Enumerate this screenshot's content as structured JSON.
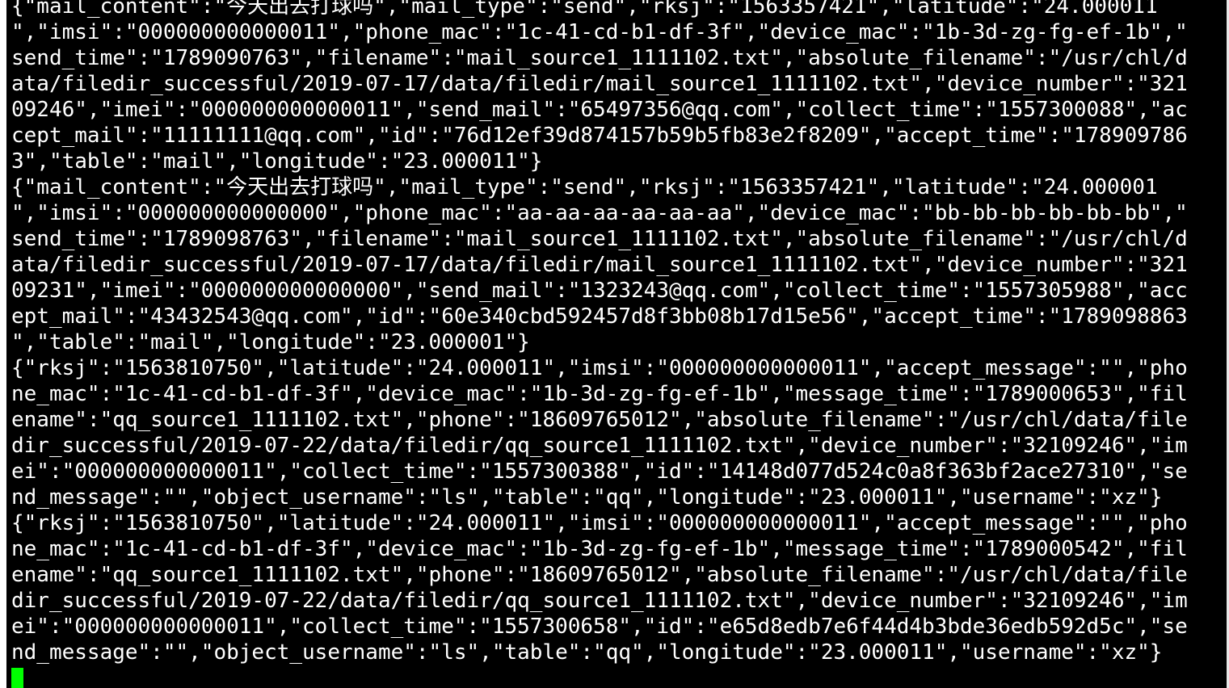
{
  "terminal": {
    "lines": [
      "{\"mail_content\":\"今天出去打球吗\",\"mail_type\":\"send\",\"rksj\":\"1563357421\",\"latitude\":\"24.000011",
      "\",\"imsi\":\"000000000000011\",\"phone_mac\":\"1c-41-cd-b1-df-3f\",\"device_mac\":\"1b-3d-zg-fg-ef-1b\",\"",
      "send_time\":\"1789090763\",\"filename\":\"mail_source1_1111102.txt\",\"absolute_filename\":\"/usr/chl/d",
      "ata/filedir_successful/2019-07-17/data/filedir/mail_source1_1111102.txt\",\"device_number\":\"321",
      "09246\",\"imei\":\"000000000000011\",\"send_mail\":\"65497356@qq.com\",\"collect_time\":\"1557300088\",\"ac",
      "cept_mail\":\"11111111@qq.com\",\"id\":\"76d12ef39d874157b59b5fb83e2f8209\",\"accept_time\":\"178909786",
      "3\",\"table\":\"mail\",\"longitude\":\"23.000011\"}",
      "{\"mail_content\":\"今天出去打球吗\",\"mail_type\":\"send\",\"rksj\":\"1563357421\",\"latitude\":\"24.000001",
      "\",\"imsi\":\"000000000000000\",\"phone_mac\":\"aa-aa-aa-aa-aa-aa\",\"device_mac\":\"bb-bb-bb-bb-bb-bb\",\"",
      "send_time\":\"1789098763\",\"filename\":\"mail_source1_1111102.txt\",\"absolute_filename\":\"/usr/chl/d",
      "ata/filedir_successful/2019-07-17/data/filedir/mail_source1_1111102.txt\",\"device_number\":\"321",
      "09231\",\"imei\":\"000000000000000\",\"send_mail\":\"1323243@qq.com\",\"collect_time\":\"1557305988\",\"acc",
      "ept_mail\":\"43432543@qq.com\",\"id\":\"60e340cbd592457d8f3bb08b17d15e56\",\"accept_time\":\"1789098863",
      "\",\"table\":\"mail\",\"longitude\":\"23.000001\"}",
      "{\"rksj\":\"1563810750\",\"latitude\":\"24.000011\",\"imsi\":\"000000000000011\",\"accept_message\":\"\",\"pho",
      "ne_mac\":\"1c-41-cd-b1-df-3f\",\"device_mac\":\"1b-3d-zg-fg-ef-1b\",\"message_time\":\"1789000653\",\"fil",
      "ename\":\"qq_source1_1111102.txt\",\"phone\":\"18609765012\",\"absolute_filename\":\"/usr/chl/data/file",
      "dir_successful/2019-07-22/data/filedir/qq_source1_1111102.txt\",\"device_number\":\"32109246\",\"im",
      "ei\":\"000000000000011\",\"collect_time\":\"1557300388\",\"id\":\"14148d077d524c0a8f363bf2ace27310\",\"se",
      "nd_message\":\"\",\"object_username\":\"ls\",\"table\":\"qq\",\"longitude\":\"23.000011\",\"username\":\"xz\"}",
      "{\"rksj\":\"1563810750\",\"latitude\":\"24.000011\",\"imsi\":\"000000000000011\",\"accept_message\":\"\",\"pho",
      "ne_mac\":\"1c-41-cd-b1-df-3f\",\"device_mac\":\"1b-3d-zg-fg-ef-1b\",\"message_time\":\"1789000542\",\"fil",
      "ename\":\"qq_source1_1111102.txt\",\"phone\":\"18609765012\",\"absolute_filename\":\"/usr/chl/data/file",
      "dir_successful/2019-07-22/data/filedir/qq_source1_1111102.txt\",\"device_number\":\"32109246\",\"im",
      "ei\":\"000000000000011\",\"collect_time\":\"1557300658\",\"id\":\"e65d8edb7e6f44d4b3bde36edb592d5c\",\"se",
      "nd_message\":\"\",\"object_username\":\"ls\",\"table\":\"qq\",\"longitude\":\"23.000011\",\"username\":\"xz\"}"
    ],
    "colors": {
      "background": "#000000",
      "foreground": "#ffffff",
      "cursor": "#00ff00"
    }
  }
}
